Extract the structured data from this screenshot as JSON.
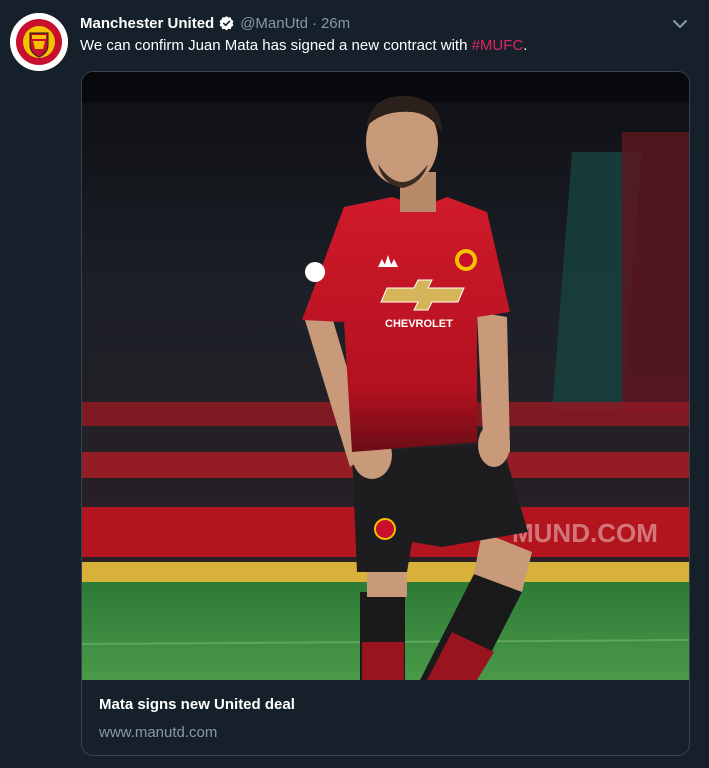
{
  "tweet": {
    "author_name": "Manchester United",
    "author_handle": "@ManUtd",
    "separator": "·",
    "timestamp": "26m",
    "text_before": "We can confirm Juan Mata has signed a new contract with ",
    "hashtag": "#MUFC",
    "text_after": ".",
    "avatar_icon": "manchester-united-crest",
    "verified_icon": "verified-badge-icon",
    "menu_icon": "chevron-down-icon"
  },
  "card": {
    "title": "Mata signs new United deal",
    "domain": "www.manutd.com",
    "image_subject": "football player in red home kit on pitch",
    "shirt_sponsor": "CHEVROLET",
    "board_text": "MUND.COM"
  },
  "colors": {
    "background": "#15202b",
    "secondary_text": "#8899a6",
    "hashtag": "#e0245e",
    "border": "#38444d",
    "kit_red": "#c8102e"
  }
}
